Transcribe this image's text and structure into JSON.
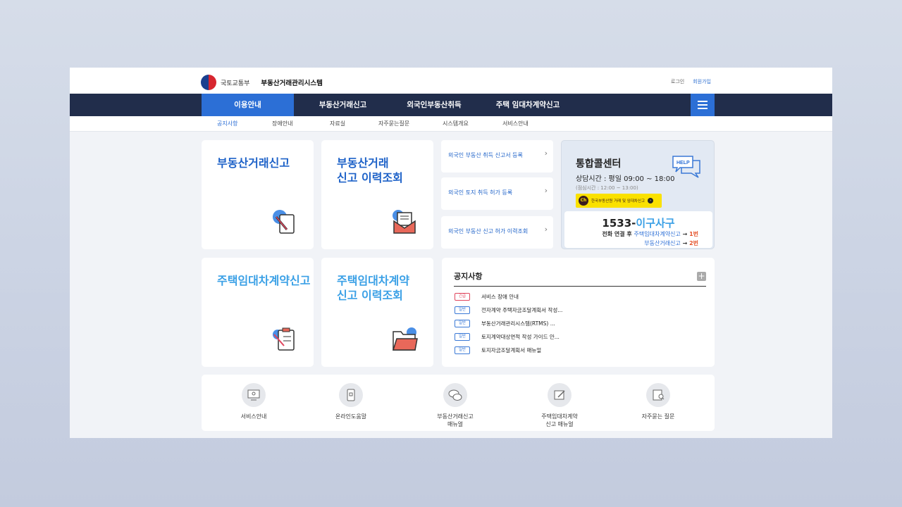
{
  "header": {
    "ministry": "국토교통부",
    "system_name": "부동산거래관리시스템",
    "login": "로그인",
    "signup": "회원가입"
  },
  "gnb": {
    "items": [
      "이용안내",
      "부동산거래신고",
      "외국인부동산취득",
      "주택 임대차계약신고"
    ],
    "active_index": 0
  },
  "lnb": {
    "items": [
      "공지사항",
      "장애안내",
      "자료실",
      "자주묻는질문",
      "시스템개요",
      "서비스안내"
    ],
    "active_index": 0
  },
  "cards": [
    {
      "title": "부동산거래신고",
      "icon": "document-pen-icon"
    },
    {
      "title": "부동산거래\n신고 이력조회",
      "icon": "mail-letter-icon"
    },
    {
      "title": "주택임대차계약신고",
      "icon": "clipboard-pen-icon"
    },
    {
      "title": "주택임대차계약\n신고 이력조회",
      "icon": "folder-icon"
    }
  ],
  "foreign_links": [
    "외국인 부동산 취득 신고서 등록",
    "외국인 토지 취득 허가 등록",
    "외국인 부동산 신고 허가 이력조회"
  ],
  "call_center": {
    "title": "통합콜센터",
    "hours": "상담시간 : 평일 09:00 ~ 18:00",
    "break": "(점심시간 : 12:00 ~ 13:00)",
    "kakao_label": "한국부동산원 거래 및 임대차신고",
    "phone_prefix": "1533-",
    "phone_suffix": "이구사구",
    "guide1_prefix": "전화 연결 후 ",
    "guide1_link": "주택임대차계약신고",
    "guide1_arrow": " → ",
    "guide1_num": "1번",
    "guide2_link": "부동산거래신고",
    "guide2_arrow": " → ",
    "guide2_num": "2번"
  },
  "notice": {
    "title": "공지사항",
    "items": [
      {
        "badge": "긴급",
        "text": "서비스 장애 안내"
      },
      {
        "badge": "일반",
        "text": "전자계약 주택자금조달계획서 작성..."
      },
      {
        "badge": "일반",
        "text": "부동산거래관리시스템(RTMS) ..."
      },
      {
        "badge": "일반",
        "text": "토지계약대상면적 작성 가이드 안..."
      },
      {
        "badge": "일반",
        "text": "토지자금조달계획서 매뉴얼"
      }
    ]
  },
  "quick_links": [
    {
      "label": "서비스안내",
      "icon": "monitor-icon"
    },
    {
      "label": "온라인도움말",
      "icon": "mobile-help-icon"
    },
    {
      "label": "부동산거래신고\n매뉴얼",
      "icon": "chat-bubbles-icon"
    },
    {
      "label": "주택임대차계약\n신고 매뉴얼",
      "icon": "pen-card-icon"
    },
    {
      "label": "자주묻는 질문",
      "icon": "book-search-icon"
    }
  ],
  "colors": {
    "nav_bg": "#212d4b",
    "accent_blue": "#2c6fd6",
    "light_blue": "#3aa0e6",
    "kakao_yellow": "#fae100"
  }
}
